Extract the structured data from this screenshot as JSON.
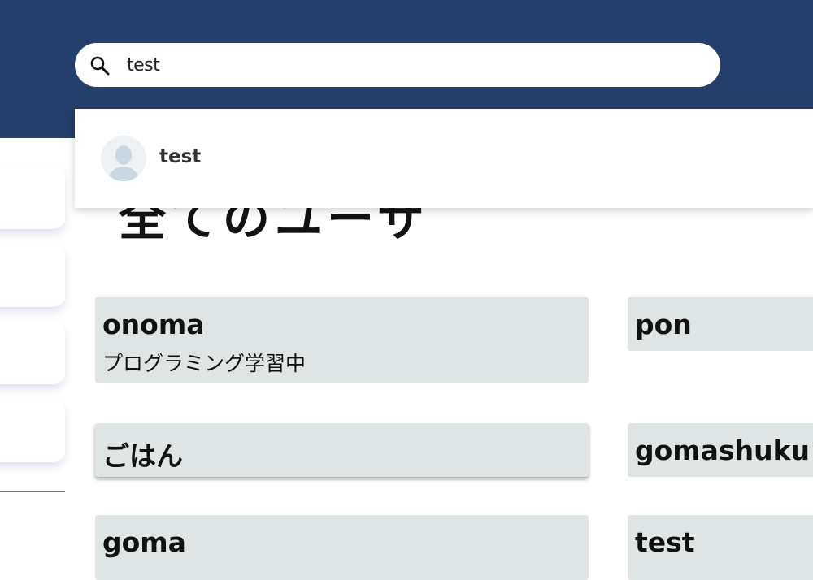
{
  "search": {
    "value": "test",
    "icon": "search-icon"
  },
  "suggestions": [
    {
      "name": "test",
      "avatar_icon": "default-user-avatar-icon"
    }
  ],
  "page": {
    "heading": "全てのユーザ"
  },
  "users": [
    {
      "name": "onoma",
      "bio": "プログラミング学習中"
    },
    {
      "name": "pon",
      "bio": ""
    },
    {
      "name": "ごはん",
      "bio": ""
    },
    {
      "name": "gomashuku",
      "bio": ""
    },
    {
      "name": "goma",
      "bio": ""
    },
    {
      "name": "test",
      "bio": ""
    }
  ],
  "colors": {
    "header": "#243f6b",
    "card": "#dfe4e4",
    "avatar": "#c9d8e2"
  }
}
